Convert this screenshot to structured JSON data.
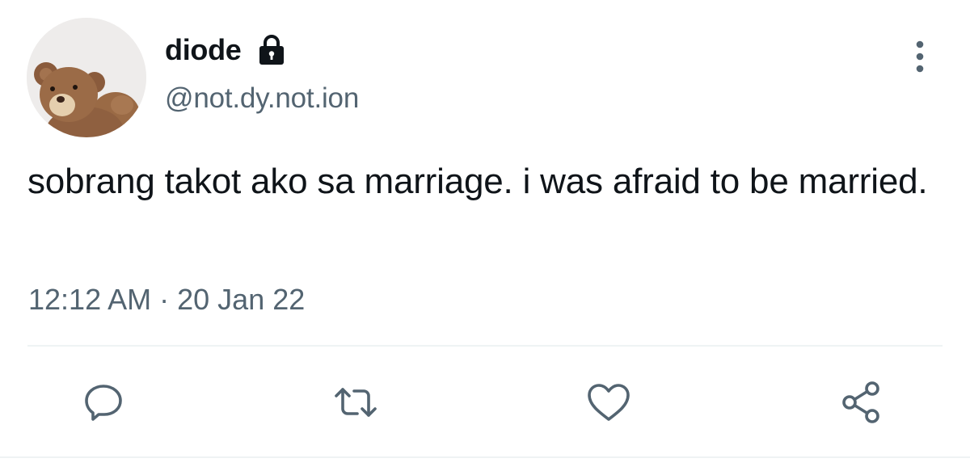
{
  "author": {
    "display_name": "diode",
    "handle": "@not.dy.not.ion",
    "avatar_icon": "teddy-bear-avatar",
    "protected_icon": "lock-icon"
  },
  "tweet": {
    "text": "sobrang takot ako sa marriage. i was afraid to be married.",
    "time": "12:12 AM",
    "separator": "·",
    "date": "20 Jan 22"
  },
  "actions": [
    {
      "icon": "reply-icon"
    },
    {
      "icon": "retweet-icon"
    },
    {
      "icon": "like-icon"
    },
    {
      "icon": "share-icon"
    }
  ],
  "colors": {
    "text_primary": "#0f1419",
    "text_secondary": "#536471",
    "divider": "#eff3f4",
    "background": "#ffffff"
  }
}
